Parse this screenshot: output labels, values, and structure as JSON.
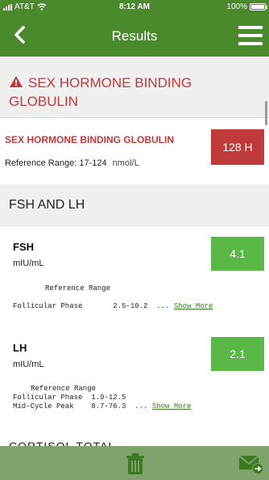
{
  "status": {
    "carrier": "AT&T",
    "time": "8:12 AM",
    "battery": "100%"
  },
  "nav": {
    "title": "Results",
    "back_icon": "chevron-left-icon",
    "menu_icon": "hamburger-icon"
  },
  "alert": {
    "title": "SEX HORMONE BINDING GLOBULIN",
    "icon": "warning-icon"
  },
  "sex_hormone": {
    "name": "SEX HORMONE BINDING GLOBULIN",
    "value": "128 H",
    "ref_label": "Reference Range:",
    "ref_range": "17-124",
    "unit": "nmol/L",
    "status_color": "#c0393b"
  },
  "fsh_lh_section": {
    "title": "FSH AND LH"
  },
  "fsh": {
    "name": "FSH",
    "unit": "mIU/mL",
    "value": "4.1",
    "ref_header": "Reference Range",
    "ref_line": "Follicular Phase       2.5-10.2  ... ",
    "show_more": "Show More"
  },
  "lh": {
    "name": "LH",
    "unit": "mIU/mL",
    "value": "2.1",
    "ref_header": "Reference Range",
    "ref_line1": "Follicular Phase  1.9-12.5",
    "ref_line2": "Mid-Cycle Peak    8.7-76.3  ... ",
    "show_more": "Show More"
  },
  "next_section": {
    "title": "CORTISOL TOTAL"
  },
  "bottom": {
    "trash_icon": "trash-icon",
    "mail_icon": "mail-forward-icon"
  },
  "colors": {
    "brand_green": "#4a8a2c",
    "normal_green": "#5ab946",
    "alert_red": "#c0393b",
    "bottom_bar": "#7fa36b"
  }
}
